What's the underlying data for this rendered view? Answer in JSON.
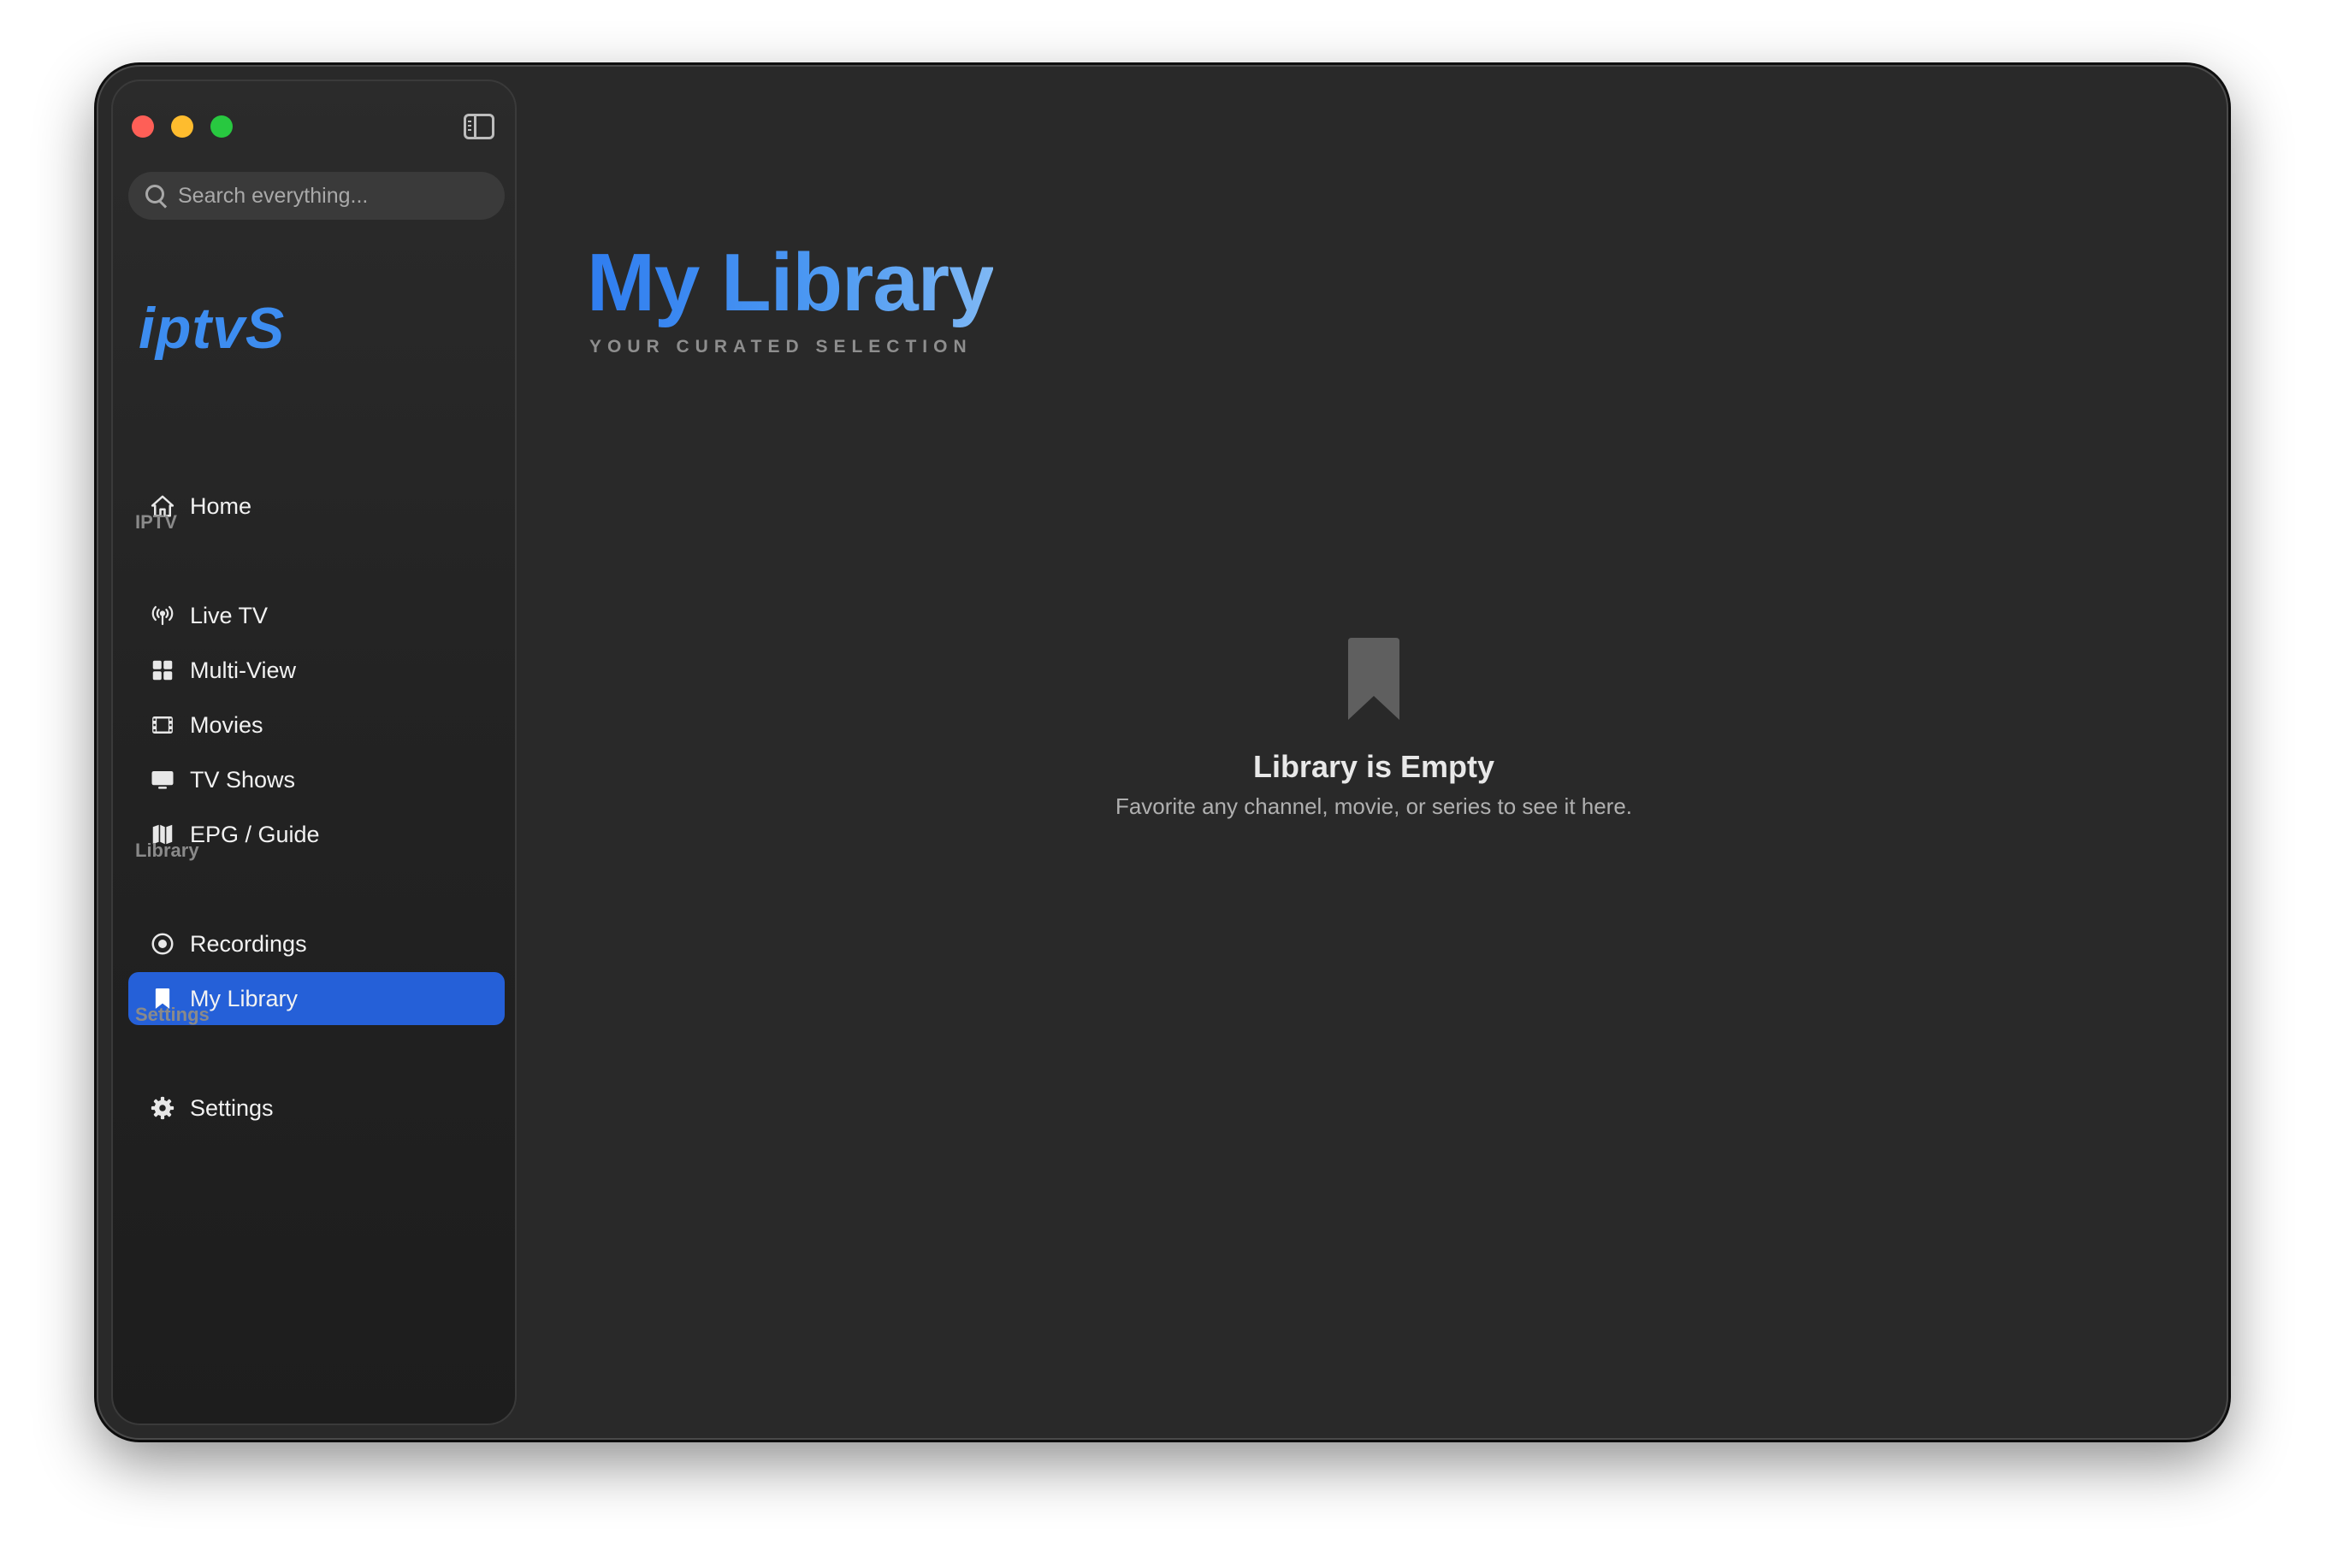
{
  "search": {
    "placeholder": "Search everything..."
  },
  "logo": "iptvS",
  "nav": {
    "home": "Home",
    "section_iptv": "IPTV",
    "live_tv": "Live TV",
    "multi_view": "Multi-View",
    "movies": "Movies",
    "tv_shows": "TV Shows",
    "epg_guide": "EPG / Guide",
    "section_library": "Library",
    "recordings": "Recordings",
    "my_library": "My Library",
    "section_settings": "Settings",
    "settings": "Settings",
    "active": "my_library"
  },
  "main": {
    "title": "My Library",
    "subtitle": "YOUR CURATED SELECTION",
    "empty_title": "Library is Empty",
    "empty_description": "Favorite any channel, movie, or series to see it here."
  },
  "colors": {
    "accent": "#2560d8",
    "logo": "#3d8df0",
    "title_gradient_start": "#2f7df0",
    "title_gradient_end": "#7fb8f4"
  },
  "icons": [
    "search-icon",
    "sidebar-toggle-icon",
    "home-icon",
    "antenna-icon",
    "grid-icon",
    "film-icon",
    "display-icon",
    "map-icon",
    "record-icon",
    "bookmark-icon",
    "gear-icon"
  ]
}
